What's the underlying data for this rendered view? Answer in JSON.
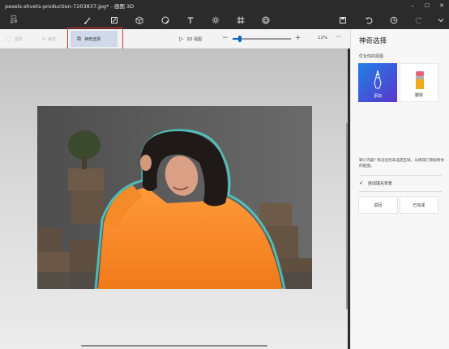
{
  "window": {
    "title": "pexels-shvets-production-7203837.jpg* - 画图 3D",
    "minimize": "–",
    "maximize": "☐",
    "close": "✕"
  },
  "ribbon": {
    "menu_label": "菜单",
    "tools": [
      "brushes-icon",
      "2d-shapes-icon",
      "3d-shapes-icon",
      "stickers-icon",
      "text-icon",
      "effects-icon",
      "canvas-icon",
      "3d-library-icon",
      "paste-icon",
      "undo-icon",
      "history-icon",
      "redo-icon",
      "collapse-icon"
    ]
  },
  "command_bar": {
    "select_label": "选择",
    "crop_label": "裁剪",
    "magic_select_label": "神奇选择",
    "view3d_label": "3D 视图",
    "zoom_value": "12%",
    "zoom_fraction": 0.13,
    "more": "···"
  },
  "panel": {
    "title": "神奇选择",
    "subtitle": "优化你的抠图",
    "add_label": "添加",
    "remove_label": "删除",
    "hint": "缺少内容? 标记任何未选定区域，以将其们添加到你的抠图。",
    "autofill_label": "自动填充背景",
    "back_label": "返回",
    "done_label": "已完成"
  },
  "colors": {
    "accent": "#0a64c8",
    "highlight": "#e03232",
    "add_card_from": "#1f7fe8",
    "add_card_to": "#5a36c9"
  }
}
